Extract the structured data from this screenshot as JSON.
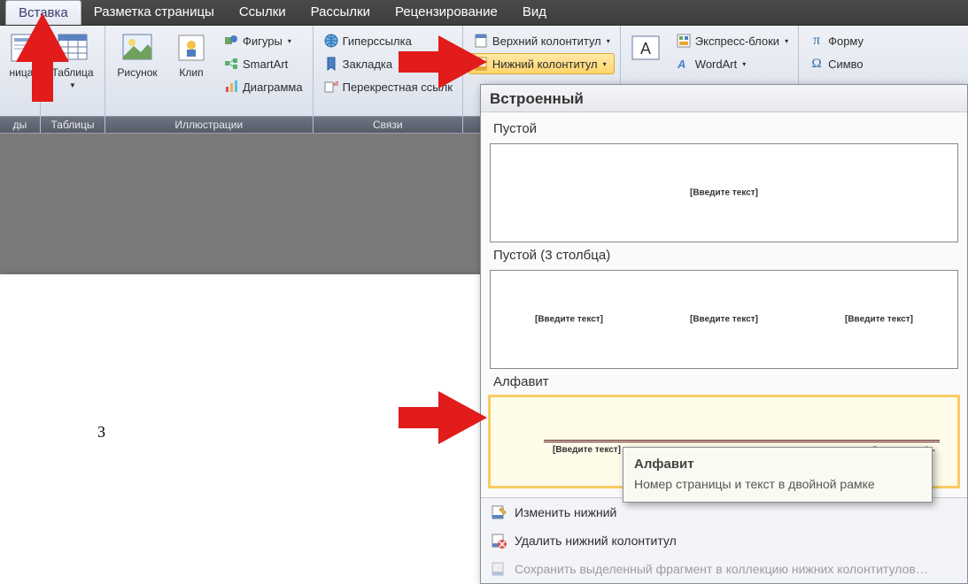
{
  "tabs": {
    "insert": "Вставка",
    "page_layout": "Разметка страницы",
    "references": "Ссылки",
    "mailings": "Рассылки",
    "review": "Рецензирование",
    "view": "Вид"
  },
  "ribbon": {
    "pages": {
      "label": "ды",
      "item": "ница"
    },
    "tables": {
      "label": "Таблицы",
      "table": "Таблица"
    },
    "illustrations": {
      "label": "Иллюстрации",
      "picture": "Рисунок",
      "clip": "Клип",
      "shapes": "Фигуры",
      "smartart": "SmartArt",
      "chart": "Диаграмма"
    },
    "links": {
      "label": "Связи",
      "hyperlink": "Гиперссылка",
      "bookmark": "Закладка",
      "crossref": "Перекрестная ссылк"
    },
    "headerfooter": {
      "header": "Верхний колонтитул",
      "footer": "Нижний колонтитул"
    },
    "text": {
      "quickparts": "Экспресс-блоки",
      "wordart": "WordArt"
    },
    "symbols": {
      "equation": "Форму",
      "symbol": "Симво"
    }
  },
  "gallery": {
    "heading": "Встроенный",
    "empty": "Пустой",
    "three": "Пустой (3 столбца)",
    "alphabet": "Алфавит",
    "placeholder": "[Введите текст]",
    "pageno": "Страница - 1 -",
    "edit": "Изменить нижний",
    "remove": "Удалить нижний колонтитул",
    "save": "Сохранить выделенный фрагмент в коллекцию нижних колонтитулов…"
  },
  "tooltip": {
    "title": "Алфавит",
    "desc": "Номер страницы и текст в двойной рамке"
  },
  "page": {
    "num": "3"
  }
}
